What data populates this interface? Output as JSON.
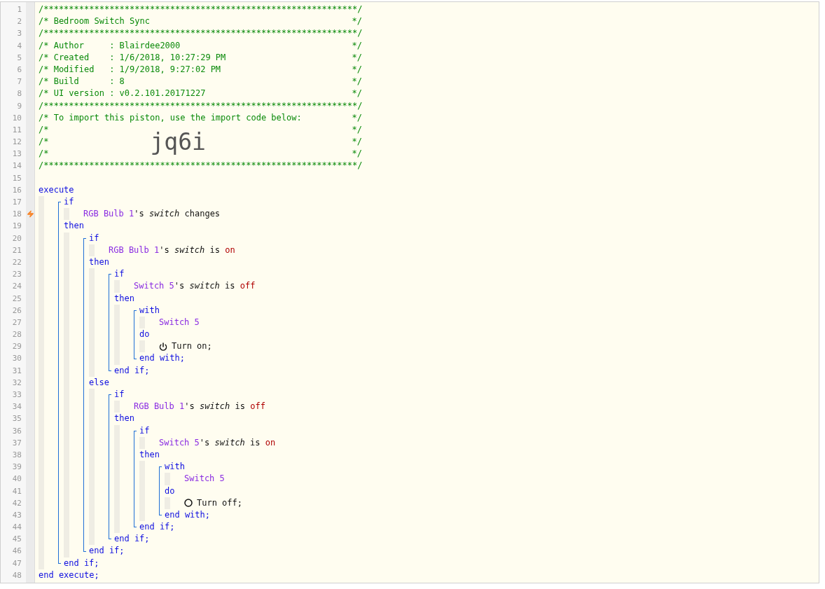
{
  "gutter": [
    {
      "number": "1"
    },
    {
      "number": "2"
    },
    {
      "number": "3"
    },
    {
      "number": "4"
    },
    {
      "number": "5"
    },
    {
      "number": "6"
    },
    {
      "number": "7"
    },
    {
      "number": "8"
    },
    {
      "number": "9"
    },
    {
      "number": "10"
    },
    {
      "number": "11"
    },
    {
      "number": "12"
    },
    {
      "number": "13"
    },
    {
      "number": "14"
    },
    {
      "number": "15"
    },
    {
      "number": "16"
    },
    {
      "number": "17"
    },
    {
      "number": "18",
      "trigger": true
    },
    {
      "number": "19"
    },
    {
      "number": "20"
    },
    {
      "number": "21"
    },
    {
      "number": "22"
    },
    {
      "number": "23"
    },
    {
      "number": "24"
    },
    {
      "number": "25"
    },
    {
      "number": "26"
    },
    {
      "number": "27"
    },
    {
      "number": "28"
    },
    {
      "number": "29"
    },
    {
      "number": "30"
    },
    {
      "number": "31"
    },
    {
      "number": "32"
    },
    {
      "number": "33"
    },
    {
      "number": "34"
    },
    {
      "number": "35"
    },
    {
      "number": "36"
    },
    {
      "number": "37"
    },
    {
      "number": "38"
    },
    {
      "number": "39"
    },
    {
      "number": "40"
    },
    {
      "number": "41"
    },
    {
      "number": "42"
    },
    {
      "number": "43"
    },
    {
      "number": "44"
    },
    {
      "number": "45"
    },
    {
      "number": "46"
    },
    {
      "number": "47"
    },
    {
      "number": "48"
    }
  ],
  "header": [
    {
      "kind": "comment",
      "text": "/**************************************************************/"
    },
    {
      "kind": "comment",
      "text": "/* Bedroom Switch Sync",
      "end": "*/"
    },
    {
      "kind": "comment",
      "text": "/**************************************************************/"
    },
    {
      "kind": "comment",
      "text": "/* Author     : Blairdee2000",
      "end": "*/"
    },
    {
      "kind": "comment",
      "text": "/* Created    : 1/6/2018, 10:27:29 PM",
      "end": "*/"
    },
    {
      "kind": "comment",
      "text": "/* Modified   : 1/9/2018, 9:27:02 PM",
      "end": "*/"
    },
    {
      "kind": "comment",
      "text": "/* Build      : 8",
      "end": "*/"
    },
    {
      "kind": "comment",
      "text": "/* UI version : v0.2.101.20171227",
      "end": "*/"
    },
    {
      "kind": "comment",
      "text": "/**************************************************************/"
    },
    {
      "kind": "comment",
      "text": "/* To import this piston, use the import code below:",
      "end": "*/"
    },
    {
      "kind": "comment",
      "text": "/*",
      "end": "*/"
    },
    {
      "kind": "import_code",
      "text": "/*",
      "code": "jq6i",
      "end": "*/"
    },
    {
      "kind": "comment",
      "text": "/*",
      "end": "*/"
    },
    {
      "kind": "comment",
      "text": "/**************************************************************/"
    }
  ],
  "program": {
    "keyword": "execute",
    "end": "end execute;",
    "body": [
      {
        "kind": "if",
        "keyword": "if",
        "condition": [
          [
            {
              "kind": "device",
              "text": "RGB Bulb 1"
            },
            {
              "kind": "plain",
              "text": "'s "
            },
            {
              "kind": "attribute",
              "text": "switch"
            },
            {
              "kind": "plain",
              "text": " changes"
            }
          ]
        ],
        "then_keyword": "then",
        "then": [
          {
            "kind": "if",
            "keyword": "if",
            "condition": [
              [
                {
                  "kind": "device",
                  "text": "RGB Bulb 1"
                },
                {
                  "kind": "plain",
                  "text": "'s "
                },
                {
                  "kind": "attribute",
                  "text": "switch"
                },
                {
                  "kind": "plain",
                  "text": " is "
                },
                {
                  "kind": "value",
                  "text": "on"
                }
              ]
            ],
            "then_keyword": "then",
            "then": [
              {
                "kind": "if",
                "keyword": "if",
                "condition": [
                  [
                    {
                      "kind": "device",
                      "text": "Switch 5"
                    },
                    {
                      "kind": "plain",
                      "text": "'s "
                    },
                    {
                      "kind": "attribute",
                      "text": "switch"
                    },
                    {
                      "kind": "plain",
                      "text": " is "
                    },
                    {
                      "kind": "value",
                      "text": "off"
                    }
                  ]
                ],
                "then_keyword": "then",
                "then": [
                  {
                    "kind": "with",
                    "keyword": "with",
                    "devices": [
                      [
                        {
                          "kind": "device",
                          "text": "Switch 5"
                        }
                      ]
                    ],
                    "do_keyword": "do",
                    "do": [
                      {
                        "kind": "power_on",
                        "text": "Turn on;"
                      }
                    ],
                    "end": "end with;"
                  }
                ],
                "end": "end if;"
              }
            ],
            "else_keyword": "else",
            "else": [
              {
                "kind": "if",
                "keyword": "if",
                "condition": [
                  [
                    {
                      "kind": "device",
                      "text": "RGB Bulb 1"
                    },
                    {
                      "kind": "plain",
                      "text": "'s "
                    },
                    {
                      "kind": "attribute",
                      "text": "switch"
                    },
                    {
                      "kind": "plain",
                      "text": " is "
                    },
                    {
                      "kind": "value",
                      "text": "off"
                    }
                  ]
                ],
                "then_keyword": "then",
                "then": [
                  {
                    "kind": "if",
                    "keyword": "if",
                    "condition": [
                      [
                        {
                          "kind": "device",
                          "text": "Switch 5"
                        },
                        {
                          "kind": "plain",
                          "text": "'s "
                        },
                        {
                          "kind": "attribute",
                          "text": "switch"
                        },
                        {
                          "kind": "plain",
                          "text": " is "
                        },
                        {
                          "kind": "value",
                          "text": "on"
                        }
                      ]
                    ],
                    "then_keyword": "then",
                    "then": [
                      {
                        "kind": "with",
                        "keyword": "with",
                        "devices": [
                          [
                            {
                              "kind": "device",
                              "text": "Switch 5"
                            }
                          ]
                        ],
                        "do_keyword": "do",
                        "do": [
                          {
                            "kind": "power_off",
                            "text": "Turn off;"
                          }
                        ],
                        "end": "end with;"
                      }
                    ],
                    "end": "end if;"
                  }
                ],
                "end": "end if;"
              }
            ],
            "end": "end if;"
          }
        ],
        "end": "end if;"
      }
    ]
  }
}
